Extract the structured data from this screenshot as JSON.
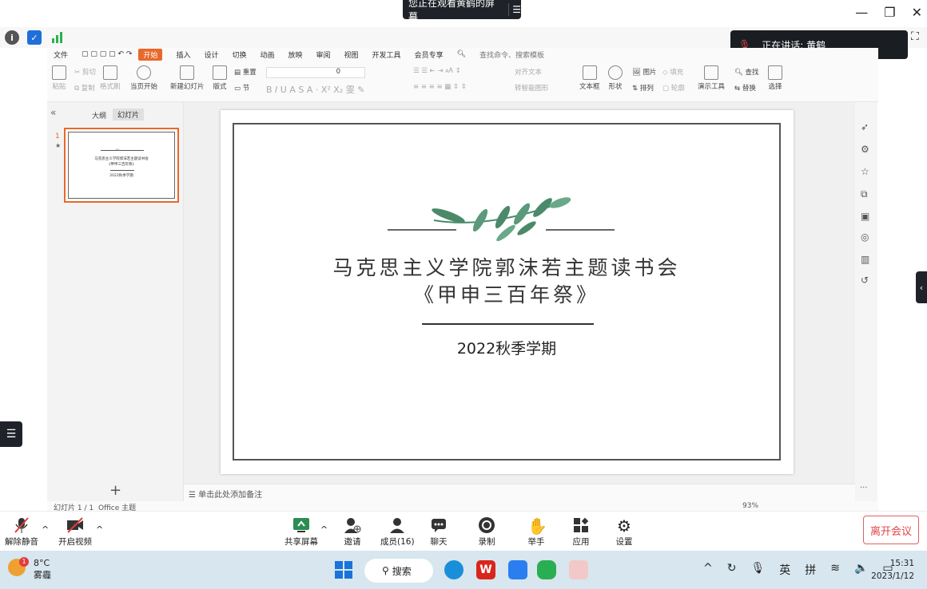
{
  "share_banner": {
    "text": "您正在观看黄鹤的屏幕",
    "menu_icon": "list-icon"
  },
  "speaking": {
    "label": "正在讲话: 黄鹤"
  },
  "ribbon": {
    "menu": [
      "文件",
      "开始",
      "插入",
      "设计",
      "切换",
      "动画",
      "放映",
      "审阅",
      "视图",
      "开发工具",
      "会员专享"
    ],
    "search_placeholder": "查找命令、搜索模板",
    "tools": {
      "paste": "粘贴",
      "cut": "剪切",
      "copy": "复制",
      "format_painter": "格式刷",
      "from_current": "当页开始",
      "new_slide": "新建幻灯片",
      "layout": "版式",
      "section": "节",
      "reset": "重置",
      "font_size": "0",
      "text_box": "文本框",
      "shape": "形状",
      "arrange": "排列",
      "picture": "图片",
      "fill": "填充",
      "outline": "轮廓",
      "align_text": "对齐文本",
      "convert_smart": "转智能图形",
      "text_direction": "文字方向",
      "presenter": "演示工具",
      "find": "查找",
      "replace": "替换",
      "select": "选择"
    }
  },
  "left_panel": {
    "tab_outline": "大纲",
    "tab_slides": "幻灯片",
    "slide_number": "1",
    "add_label": "+"
  },
  "slide": {
    "title_line1": "马克思主义学院郭沫若主题读书会",
    "title_line2": "《甲申三百年祭》",
    "subtitle": "2022秋季学期"
  },
  "notes": {
    "placeholder": "单击此处添加备注"
  },
  "status": {
    "slide_info": "幻灯片 1 / 1",
    "theme": "Office 主题",
    "zoom": "93%"
  },
  "meeting_bar": {
    "unmute": "解除静音",
    "start_video": "开启视频",
    "share_screen": "共享屏幕",
    "invite": "邀请",
    "members": "成员(16)",
    "chat": "聊天",
    "record": "录制",
    "raise_hand": "举手",
    "apps": "应用",
    "settings": "设置",
    "leave": "离开会议"
  },
  "taskbar": {
    "weather_temp": "8°C",
    "weather_desc": "雾霾",
    "weather_badge": "1",
    "search": "搜索",
    "tray_lang": "英",
    "tray_ime": "拼",
    "time": "15:31",
    "date": "2023/1/12"
  },
  "colors": {
    "accent_orange": "#e8692a",
    "dark_bar": "#1f2329",
    "leave_red": "#e04545",
    "leaf_green": "#4a8a6a"
  }
}
